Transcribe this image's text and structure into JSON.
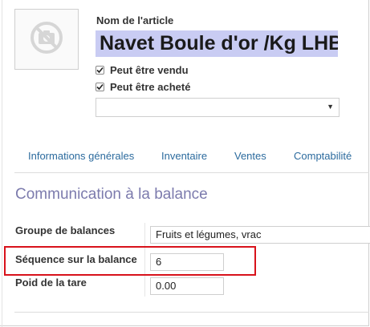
{
  "product": {
    "name_label": "Nom de l'article",
    "name_value": "Navet Boule d'or /Kg LHB",
    "image_icon": "camera-off-icon",
    "sale_ok_label": "Peut être vendu",
    "sale_ok": true,
    "purchase_ok_label": "Peut être acheté",
    "purchase_ok": true,
    "category_value": ""
  },
  "tabs": [
    {
      "label": "Informations générales"
    },
    {
      "label": "Inventaire"
    },
    {
      "label": "Ventes"
    },
    {
      "label": "Comptabilité"
    }
  ],
  "section": {
    "title": "Communication à la balance",
    "fields": [
      {
        "label": "Groupe de balances",
        "value": "Fruits et légumes, vrac"
      },
      {
        "label": "Séquence sur la balance",
        "value": "6"
      },
      {
        "label": "Poid de la tare",
        "value": "0.00"
      }
    ]
  },
  "colors": {
    "name_highlight": "#c9ccf3",
    "tab_link": "#2c6b9e",
    "section_title": "#7c7bad",
    "annotation_box": "#d8121b"
  }
}
